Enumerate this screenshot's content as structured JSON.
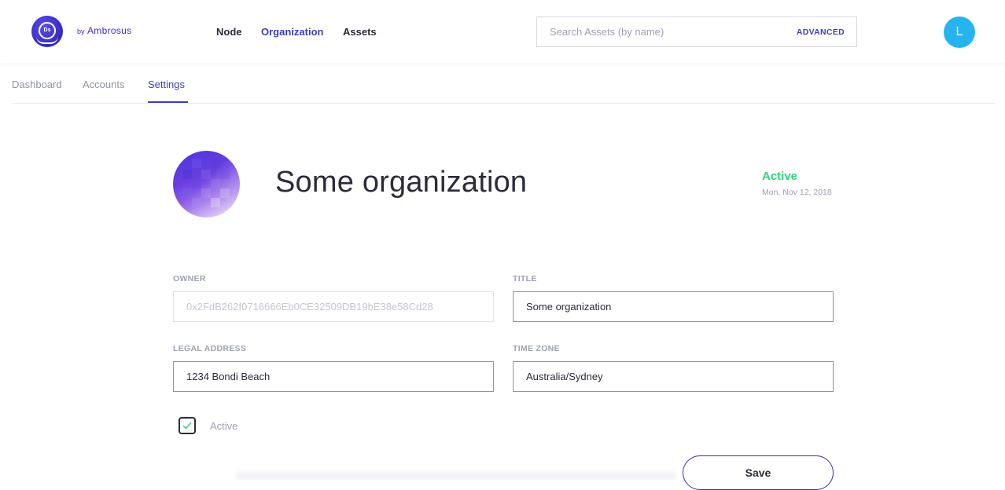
{
  "header": {
    "logo_text": "Ds",
    "by_label": "by",
    "brand_name": "Ambrosus",
    "nav": [
      {
        "label": "Node"
      },
      {
        "label": "Organization"
      },
      {
        "label": "Assets"
      }
    ],
    "active_nav": "Organization",
    "search": {
      "placeholder": "Search Assets (by name)",
      "value": "",
      "advanced_label": "ADVANCED"
    },
    "user_initial": "L",
    "avatar_color": "#25b4f0"
  },
  "subnav": {
    "tabs": [
      {
        "label": "Dashboard"
      },
      {
        "label": "Accounts"
      },
      {
        "label": "Settings"
      }
    ],
    "active_tab": "Settings"
  },
  "organization": {
    "name": "Some organization",
    "status": "Active",
    "date": "Mon, Nov 12, 2018",
    "status_color": "#2ed47a"
  },
  "form": {
    "owner_label": "OWNER",
    "owner_value": "0x2FdB262f0716666Eb0CE32509DB19bE38e58Cd28",
    "title_label": "TITLE",
    "title_value": "Some organization",
    "address_label": "LEGAL ADDRESS",
    "address_value": "1234 Bondi Beach",
    "timezone_label": "TIME ZONE",
    "timezone_value": "Australia/Sydney",
    "active_label": "Active",
    "active_checked": true,
    "save_label": "Save"
  },
  "colors": {
    "accent": "#3a3fc0",
    "brand": "#3a2fc4"
  }
}
